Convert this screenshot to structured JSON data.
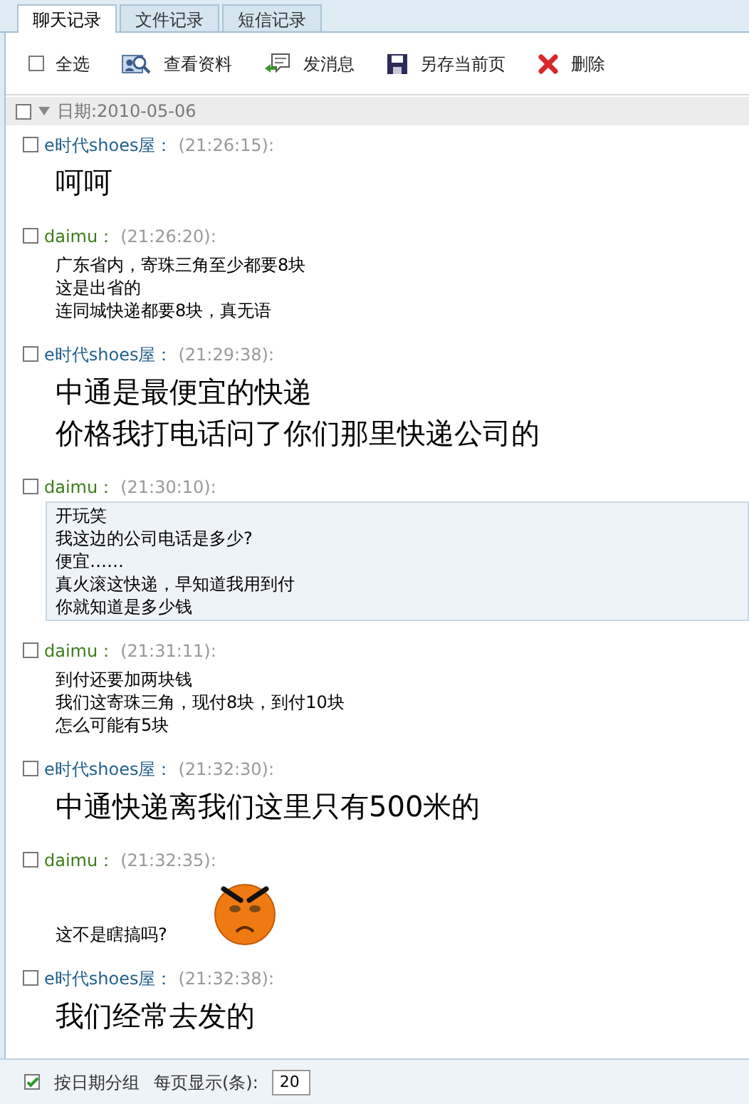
{
  "tabs": [
    {
      "label": "聊天记录",
      "selected": true
    },
    {
      "label": "文件记录",
      "selected": false
    },
    {
      "label": "短信记录",
      "selected": false
    }
  ],
  "toolbar": {
    "select_all": {
      "label": "全选",
      "checked": false
    },
    "actions": [
      {
        "kind": "profile",
        "label": "查看资料"
      },
      {
        "kind": "message",
        "label": "发消息"
      },
      {
        "kind": "save",
        "label": "另存当前页"
      },
      {
        "kind": "delete",
        "label": "删除"
      }
    ]
  },
  "date_group": {
    "label": "日期:2010-05-06",
    "checked": false,
    "expanded": true
  },
  "messages": [
    {
      "sender": "e时代shoes屋：",
      "color": "#1f5f8b",
      "time": "(21:26:15):",
      "checked": false,
      "large_text": true,
      "highlighted": false,
      "kind": "text",
      "lines": [
        "呵呵"
      ]
    },
    {
      "sender": "daimu：",
      "color": "#3d7c19",
      "time": "(21:26:20):",
      "checked": false,
      "large_text": false,
      "highlighted": false,
      "kind": "text",
      "lines": [
        "广东省内，寄珠三角至少都要8块",
        "这是出省的",
        "连同城快递都要8块，真无语"
      ]
    },
    {
      "sender": "e时代shoes屋：",
      "color": "#1f5f8b",
      "time": "(21:29:38):",
      "checked": false,
      "large_text": true,
      "highlighted": false,
      "kind": "text",
      "lines": [
        "中通是最便宜的快递",
        "价格我打电话问了你们那里快递公司的"
      ]
    },
    {
      "sender": "daimu：",
      "color": "#3d7c19",
      "time": "(21:30:10):",
      "checked": false,
      "large_text": false,
      "highlighted": true,
      "kind": "text",
      "lines": [
        "开玩笑",
        "我这边的公司电话是多少?",
        "便宜……",
        "真火滚这快递，早知道我用到付",
        "你就知道是多少钱"
      ]
    },
    {
      "sender": "daimu：",
      "color": "#3d7c19",
      "time": "(21:31:11):",
      "checked": false,
      "large_text": false,
      "highlighted": false,
      "kind": "text",
      "lines": [
        "到付还要加两块钱",
        "我们这寄珠三角，现付8块，到付10块",
        "怎么可能有5块"
      ]
    },
    {
      "sender": "e时代shoes屋：",
      "color": "#1f5f8b",
      "time": "(21:32:30):",
      "checked": false,
      "large_text": true,
      "highlighted": false,
      "kind": "text",
      "lines": [
        "中通快递离我们这里只有500米的"
      ]
    },
    {
      "sender": "daimu：",
      "color": "#3d7c19",
      "time": "(21:32:35):",
      "checked": false,
      "large_text": false,
      "highlighted": false,
      "kind": "emoticon",
      "lines": [
        "这不是瞎搞吗?"
      ]
    },
    {
      "sender": "e时代shoes屋：",
      "color": "#1f5f8b",
      "time": "(21:32:38):",
      "checked": false,
      "large_text": true,
      "highlighted": false,
      "kind": "text",
      "lines": [
        "我们经常去发的"
      ]
    }
  ],
  "footer": {
    "group_by_date": {
      "label": "按日期分组",
      "checked": true
    },
    "page_size": {
      "label": "每页显示(条):",
      "value": "20"
    }
  }
}
